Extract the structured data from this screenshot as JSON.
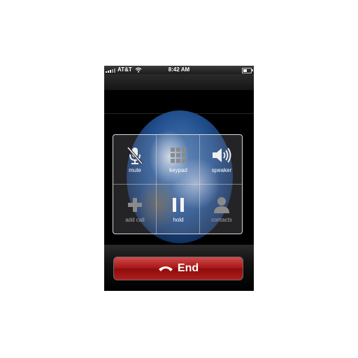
{
  "status_bar": {
    "carrier": "AT&T",
    "time": "8:42 AM"
  },
  "call_controls": [
    {
      "label": "mute",
      "icon": "mute-microphone-icon",
      "enabled": true
    },
    {
      "label": "keypad",
      "icon": "keypad-grid-icon",
      "enabled": false
    },
    {
      "label": "speaker",
      "icon": "speaker-icon",
      "enabled": true
    },
    {
      "label": "add call",
      "icon": "plus-icon",
      "enabled": false
    },
    {
      "label": "hold",
      "icon": "pause-icon",
      "enabled": true
    },
    {
      "label": "contacts",
      "icon": "person-icon",
      "enabled": false
    }
  ],
  "end_button": {
    "label": "End",
    "icon": "phone-hangup-icon",
    "color": "#b01e1e"
  },
  "colors": {
    "end_red": "#b01e1e",
    "enabled_label": "#ffffff",
    "disabled_label": "#a8a8a8"
  }
}
